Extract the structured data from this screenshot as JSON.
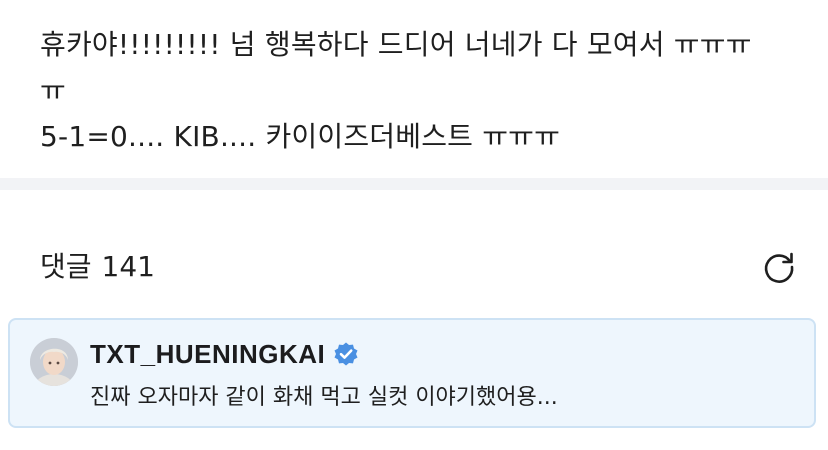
{
  "post": {
    "lines": [
      "휴카야!!!!!!!!! 넘 행복하다 드디어 너네가 다 모여서 ㅠㅠㅠ",
      "ㅠ",
      "5-1=0.... KIB.... 카이이즈더베스트 ㅠㅠㅠ"
    ]
  },
  "comments": {
    "label": "댓글",
    "count": "141",
    "refresh_icon": "refresh-icon"
  },
  "pinned_comment": {
    "author": "TXT_HUENINGKAI",
    "verified_icon": "verified-badge-icon",
    "text": "진짜 오자마자 같이 화채 먹고 실컷 이야기했어용...",
    "background": "#eef6fd",
    "border": "#cde2f4",
    "badge_color": "#4a90e2"
  }
}
